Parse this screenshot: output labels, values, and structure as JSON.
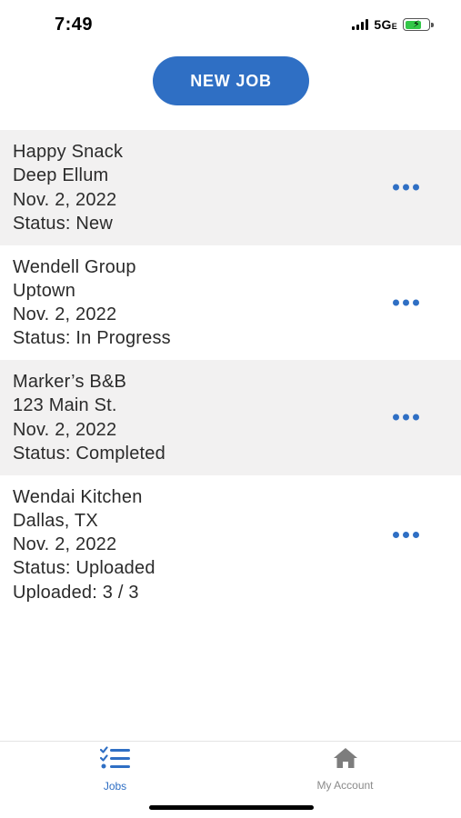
{
  "status_bar": {
    "time": "7:49",
    "network": "5G",
    "network_suffix": "E",
    "battery_charging": true,
    "battery_color": "#33c748"
  },
  "header": {
    "new_job_label": "NEW JOB"
  },
  "jobs": [
    {
      "name": "Happy Snack",
      "location": "Deep Ellum",
      "date": "Nov. 2, 2022",
      "status": "Status: New"
    },
    {
      "name": "Wendell Group",
      "location": "Uptown",
      "date": "Nov. 2, 2022",
      "status": "Status: In Progress"
    },
    {
      "name": "Marker’s B&B",
      "location": "123 Main St.",
      "date": "Nov. 2, 2022",
      "status": "Status: Completed"
    },
    {
      "name": "Wendai Kitchen",
      "location": "Dallas, TX",
      "date": "Nov. 2, 2022",
      "status": "Status: Uploaded",
      "extra": "Uploaded: 3 / 3"
    }
  ],
  "more_icon": "more-horizontal-icon",
  "tab_bar": {
    "tabs": [
      {
        "label": "Jobs",
        "icon": "checklist-icon",
        "active": true
      },
      {
        "label": "My Account",
        "icon": "home-icon",
        "active": false
      }
    ]
  },
  "colors": {
    "accent": "#2f6fc4",
    "row_shade": "#f2f1f1",
    "inactive_tab": "#8a8a8a"
  }
}
